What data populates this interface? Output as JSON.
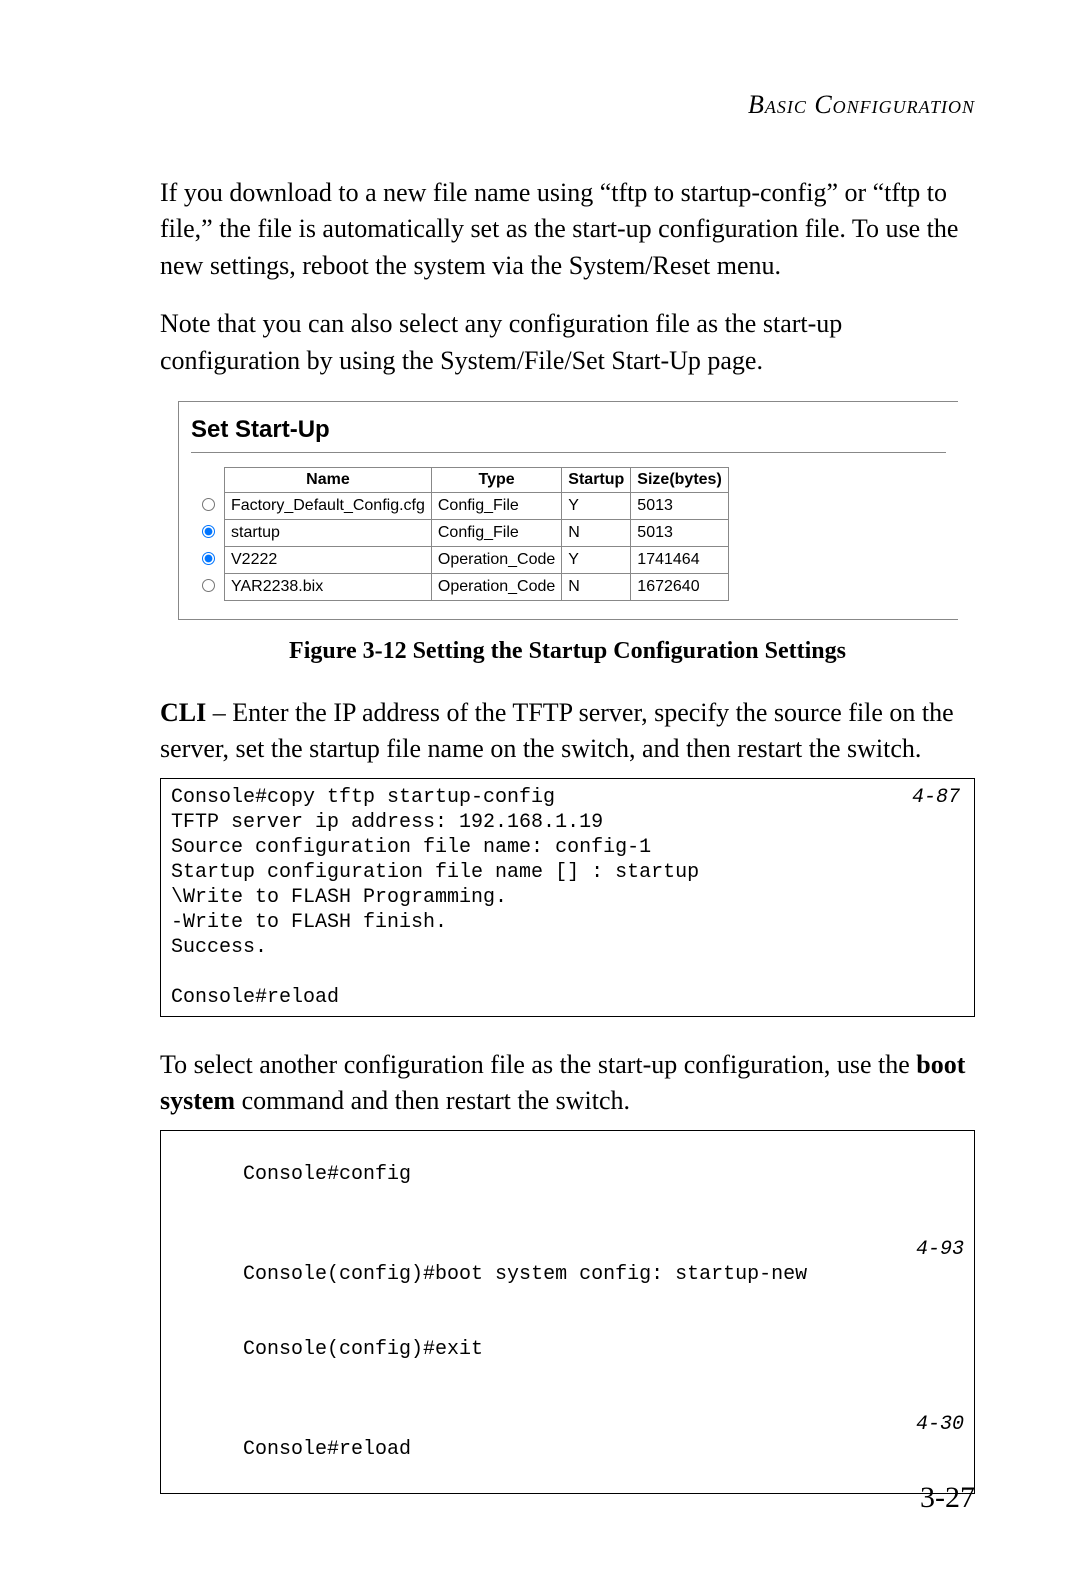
{
  "header": {
    "section_title": "Basic Configuration"
  },
  "para1": "If you download to a new file name using “tftp to startup-config” or “tftp to file,” the file is automatically set as the start-up configuration file. To use the new settings, reboot the system via the System/Reset menu.",
  "para2": "Note that you can also select any configuration file as the start-up configuration by using the System/File/Set Start-Up page.",
  "screenshot": {
    "title": "Set Start-Up",
    "columns": {
      "name": "Name",
      "type": "Type",
      "startup": "Startup",
      "size": "Size(bytes)"
    },
    "rows": [
      {
        "selected": false,
        "name": "Factory_Default_Config.cfg",
        "type": "Config_File",
        "startup": "Y",
        "size": "5013"
      },
      {
        "selected": true,
        "name": "startup",
        "type": "Config_File",
        "startup": "N",
        "size": "5013"
      },
      {
        "selected": true,
        "name": "V2222",
        "type": "Operation_Code",
        "startup": "Y",
        "size": "1741464"
      },
      {
        "selected": false,
        "name": "YAR2238.bix",
        "type": "Operation_Code",
        "startup": "N",
        "size": "1672640"
      }
    ]
  },
  "figure_caption": "Figure 3-12  Setting the Startup Configuration Settings",
  "cli_intro_bold": "CLI",
  "cli_intro_rest": " – Enter the IP address of the TFTP server, specify the source file on the server, set the startup file name on the switch, and then restart the switch.",
  "listing1": {
    "ref": "4-87",
    "lines": [
      "Console#copy tftp startup-config",
      "TFTP server ip address: 192.168.1.19",
      "Source configuration file name: config-1",
      "Startup configuration file name [] : startup",
      "\\Write to FLASH Programming.",
      "-Write to FLASH finish.",
      "Success.",
      "",
      "Console#reload"
    ]
  },
  "para3_pre": "To select another configuration file as the start-up configuration, use the ",
  "para3_bold": "boot system",
  "para3_post": " command and then restart the switch.",
  "listing2": {
    "lines": [
      {
        "text": "Console#config",
        "ref": ""
      },
      {
        "text": "Console(config)#boot system config: startup-new",
        "ref": "4-93"
      },
      {
        "text": "Console(config)#exit",
        "ref": ""
      },
      {
        "text": "Console#reload",
        "ref": "4-30"
      }
    ]
  },
  "page_number": "3-27"
}
